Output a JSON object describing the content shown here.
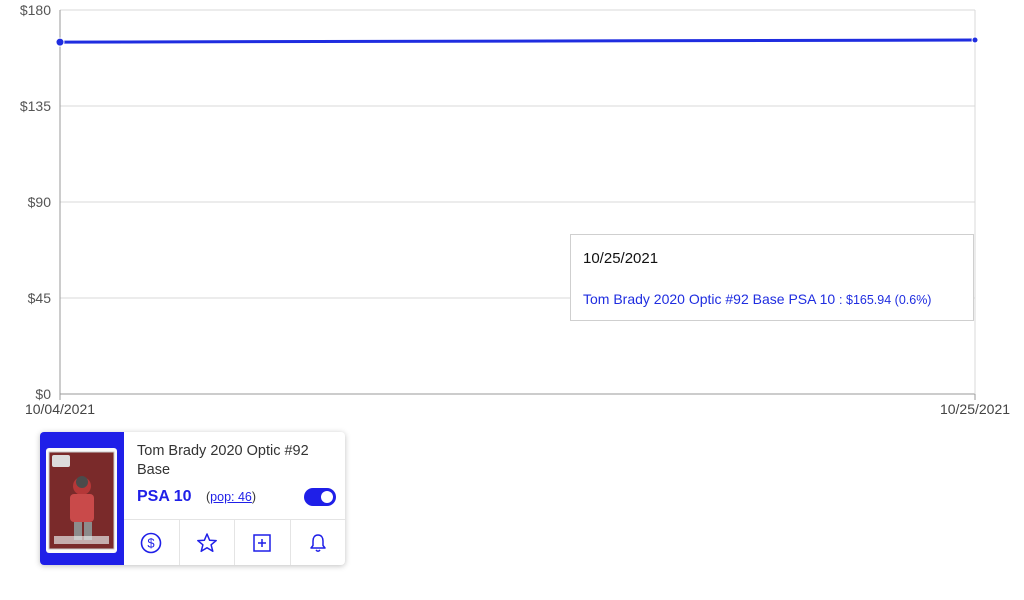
{
  "chart_data": {
    "type": "line",
    "x": [
      "10/04/2021",
      "10/25/2021"
    ],
    "series": [
      {
        "name": "Tom Brady 2020 Optic #92 Base PSA 10",
        "values": [
          164.95,
          165.94
        ]
      }
    ],
    "ylim": [
      0,
      180
    ],
    "y_ticks": [
      "$180",
      "$135",
      "$90",
      "$45",
      "$0"
    ],
    "x_ticks": [
      "10/04/2021",
      "10/25/2021"
    ],
    "grid": true,
    "line_color": "#1f2de0"
  },
  "tooltip": {
    "date": "10/25/2021",
    "series_label": "Tom Brady 2020 Optic #92 Base PSA 10",
    "value_text": ": $165.94 (0.6%)"
  },
  "card": {
    "title": "Tom Brady 2020 Optic #92 Base",
    "grade": "PSA 10",
    "pop_open": "(",
    "pop_link": "pop: 46",
    "pop_close": ")",
    "toggle_on": true,
    "actions": [
      "dollar-icon",
      "star-icon",
      "plus-square-icon",
      "bell-icon"
    ]
  },
  "colors": {
    "accent": "#1f1fe8",
    "grid": "#d8d8d8",
    "axis": "#9a9a9a"
  }
}
